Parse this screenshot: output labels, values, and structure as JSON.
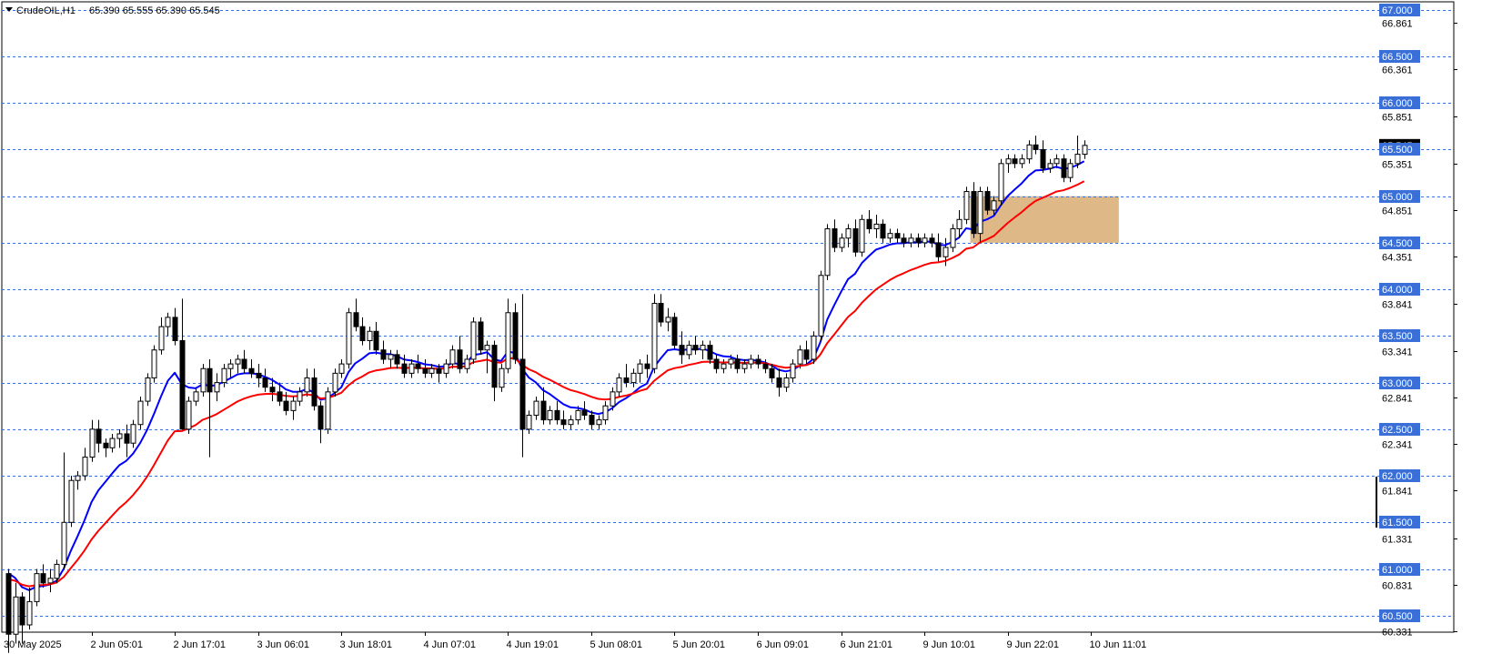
{
  "header": {
    "symbol": "CrudeOIL,H1",
    "ohlc": "65.390 65.555 65.390 65.545"
  },
  "colors": {
    "bull": "#ffffff",
    "bear": "#000000",
    "ema_fast": "#0000ff",
    "ema_slow": "#ff0000",
    "level_line": "#3a6fd8",
    "level_label_bg": "#3a6fd8",
    "zone": "#deb887",
    "current_price_bg": "#000000"
  },
  "chart_data": {
    "type": "candlestick",
    "ylim": [
      60.2,
      67.1
    ],
    "levels": [
      "67.000",
      "66.500",
      "66.000",
      "65.500",
      "65.000",
      "64.500",
      "64.000",
      "63.500",
      "63.000",
      "62.500",
      "62.000",
      "61.500",
      "61.000",
      "60.500"
    ],
    "price_ticks": [
      "66.861",
      "66.361",
      "65.851",
      "65.351",
      "64.851",
      "64.351",
      "63.841",
      "63.341",
      "62.841",
      "62.341",
      "61.841",
      "61.331",
      "60.831",
      "60.331"
    ],
    "time_ticks": [
      {
        "label": "30 May 2025",
        "bar": 0
      },
      {
        "label": "2 Jun 05:01",
        "bar": 12
      },
      {
        "label": "2 Jun 17:01",
        "bar": 24
      },
      {
        "label": "3 Jun 06:01",
        "bar": 36
      },
      {
        "label": "3 Jun 18:01",
        "bar": 48
      },
      {
        "label": "4 Jun 07:01",
        "bar": 60
      },
      {
        "label": "4 Jun 19:01",
        "bar": 72
      },
      {
        "label": "5 Jun 08:01",
        "bar": 84
      },
      {
        "label": "5 Jun 20:01",
        "bar": 96
      },
      {
        "label": "6 Jun 09:01",
        "bar": 108
      },
      {
        "label": "6 Jun 21:01",
        "bar": 120
      },
      {
        "label": "9 Jun 10:01",
        "bar": 132
      },
      {
        "label": "9 Jun 22:01",
        "bar": 144
      },
      {
        "label": "10 Jun 11:01",
        "bar": 156
      }
    ],
    "current_price": 65.545,
    "zone": {
      "from_bar": 139,
      "to_bar": 160,
      "top": 65.0,
      "bottom": 64.5
    },
    "series": [
      {
        "name": "",
        "kind": "ema",
        "period": 9,
        "seed": 61.12
      },
      {
        "name": "",
        "kind": "ema",
        "period": 21,
        "seed": 60.95
      }
    ],
    "candles": [
      [
        60.95,
        61.0,
        60.1,
        60.3
      ],
      [
        60.3,
        60.85,
        60.2,
        60.7
      ],
      [
        60.7,
        60.75,
        60.2,
        60.4
      ],
      [
        60.4,
        60.8,
        60.35,
        60.65
      ],
      [
        60.65,
        61.0,
        60.6,
        60.95
      ],
      [
        60.95,
        61.05,
        60.8,
        60.85
      ],
      [
        60.85,
        61.0,
        60.75,
        60.9
      ],
      [
        60.9,
        61.1,
        60.85,
        61.05
      ],
      [
        61.05,
        62.25,
        61.0,
        61.5
      ],
      [
        61.5,
        62.0,
        61.45,
        61.95
      ],
      [
        61.95,
        62.05,
        61.85,
        62.0
      ],
      [
        62.0,
        62.3,
        61.95,
        62.2
      ],
      [
        62.2,
        62.6,
        62.15,
        62.5
      ],
      [
        62.5,
        62.6,
        62.25,
        62.35
      ],
      [
        62.35,
        62.4,
        62.2,
        62.3
      ],
      [
        62.3,
        62.45,
        62.25,
        62.4
      ],
      [
        62.4,
        62.5,
        62.3,
        62.45
      ],
      [
        62.45,
        62.55,
        62.2,
        62.35
      ],
      [
        62.35,
        62.6,
        62.3,
        62.55
      ],
      [
        62.55,
        62.85,
        62.5,
        62.8
      ],
      [
        62.8,
        63.1,
        62.75,
        63.05
      ],
      [
        63.05,
        63.4,
        63.0,
        63.35
      ],
      [
        63.35,
        63.7,
        63.3,
        63.6
      ],
      [
        63.6,
        63.75,
        63.5,
        63.7
      ],
      [
        63.7,
        63.8,
        63.4,
        63.45
      ],
      [
        63.45,
        63.9,
        62.5,
        62.5
      ],
      [
        62.5,
        62.85,
        62.45,
        62.8
      ],
      [
        62.8,
        62.95,
        62.75,
        62.9
      ],
      [
        62.9,
        63.2,
        62.85,
        63.15
      ],
      [
        63.15,
        63.25,
        62.2,
        62.9
      ],
      [
        62.9,
        63.1,
        62.8,
        63.0
      ],
      [
        63.0,
        63.2,
        62.95,
        63.15
      ],
      [
        63.15,
        63.25,
        63.05,
        63.2
      ],
      [
        63.2,
        63.3,
        63.1,
        63.25
      ],
      [
        63.25,
        63.35,
        63.1,
        63.15
      ],
      [
        63.15,
        63.25,
        63.05,
        63.1
      ],
      [
        63.1,
        63.2,
        62.95,
        63.05
      ],
      [
        63.05,
        63.15,
        62.9,
        62.95
      ],
      [
        62.95,
        63.05,
        62.8,
        62.9
      ],
      [
        62.9,
        63.0,
        62.75,
        62.8
      ],
      [
        62.8,
        62.9,
        62.65,
        62.7
      ],
      [
        62.7,
        62.85,
        62.6,
        62.8
      ],
      [
        62.8,
        62.95,
        62.75,
        62.9
      ],
      [
        62.9,
        63.15,
        62.85,
        63.05
      ],
      [
        63.05,
        63.15,
        62.7,
        62.75
      ],
      [
        62.75,
        62.8,
        62.35,
        62.5
      ],
      [
        62.5,
        62.95,
        62.45,
        62.9
      ],
      [
        62.9,
        63.15,
        62.85,
        63.1
      ],
      [
        63.1,
        63.25,
        63.05,
        63.2
      ],
      [
        63.2,
        63.8,
        63.15,
        63.75
      ],
      [
        63.75,
        63.9,
        63.55,
        63.6
      ],
      [
        63.6,
        63.7,
        63.4,
        63.45
      ],
      [
        63.45,
        63.6,
        63.35,
        63.55
      ],
      [
        63.55,
        63.65,
        63.3,
        63.35
      ],
      [
        63.35,
        63.45,
        63.2,
        63.25
      ],
      [
        63.25,
        63.35,
        63.15,
        63.3
      ],
      [
        63.3,
        63.35,
        63.15,
        63.2
      ],
      [
        63.2,
        63.3,
        63.05,
        63.1
      ],
      [
        63.1,
        63.25,
        63.05,
        63.2
      ],
      [
        63.2,
        63.3,
        63.1,
        63.15
      ],
      [
        63.15,
        63.25,
        63.05,
        63.1
      ],
      [
        63.1,
        63.2,
        63.05,
        63.15
      ],
      [
        63.15,
        63.2,
        63.0,
        63.1
      ],
      [
        63.1,
        63.25,
        63.05,
        63.2
      ],
      [
        63.2,
        63.4,
        63.15,
        63.35
      ],
      [
        63.35,
        63.5,
        63.1,
        63.15
      ],
      [
        63.15,
        63.3,
        63.1,
        63.25
      ],
      [
        63.25,
        63.7,
        63.2,
        63.65
      ],
      [
        63.65,
        63.7,
        63.3,
        63.35
      ],
      [
        63.35,
        63.45,
        63.1,
        63.4
      ],
      [
        63.4,
        63.45,
        62.8,
        62.95
      ],
      [
        62.95,
        63.2,
        62.9,
        63.15
      ],
      [
        63.15,
        63.9,
        63.1,
        63.75
      ],
      [
        63.75,
        63.85,
        63.2,
        63.25
      ],
      [
        63.25,
        63.95,
        62.2,
        62.5
      ],
      [
        62.5,
        62.7,
        62.45,
        62.65
      ],
      [
        62.65,
        62.85,
        62.6,
        62.8
      ],
      [
        62.8,
        62.95,
        62.55,
        62.6
      ],
      [
        62.6,
        62.75,
        62.55,
        62.7
      ],
      [
        62.7,
        62.8,
        62.55,
        62.6
      ],
      [
        62.6,
        62.7,
        62.5,
        62.55
      ],
      [
        62.55,
        62.65,
        62.5,
        62.6
      ],
      [
        62.6,
        62.75,
        62.55,
        62.7
      ],
      [
        62.7,
        62.8,
        62.6,
        62.65
      ],
      [
        62.65,
        62.7,
        62.5,
        62.55
      ],
      [
        62.55,
        62.65,
        62.5,
        62.6
      ],
      [
        62.6,
        62.8,
        62.55,
        62.75
      ],
      [
        62.75,
        62.95,
        62.7,
        62.9
      ],
      [
        62.9,
        63.1,
        62.85,
        63.05
      ],
      [
        63.05,
        63.2,
        62.95,
        63.0
      ],
      [
        63.0,
        63.15,
        62.95,
        63.1
      ],
      [
        63.1,
        63.25,
        63.0,
        63.2
      ],
      [
        63.2,
        63.3,
        63.05,
        63.15
      ],
      [
        63.15,
        63.95,
        63.1,
        63.85
      ],
      [
        63.85,
        63.95,
        63.6,
        63.65
      ],
      [
        63.65,
        63.8,
        63.55,
        63.7
      ],
      [
        63.7,
        63.75,
        63.35,
        63.4
      ],
      [
        63.4,
        63.55,
        63.2,
        63.3
      ],
      [
        63.3,
        63.45,
        63.25,
        63.4
      ],
      [
        63.4,
        63.5,
        63.3,
        63.35
      ],
      [
        63.35,
        63.45,
        63.25,
        63.4
      ],
      [
        63.4,
        63.45,
        63.2,
        63.25
      ],
      [
        63.25,
        63.3,
        63.1,
        63.15
      ],
      [
        63.15,
        63.25,
        63.1,
        63.2
      ],
      [
        63.2,
        63.3,
        63.15,
        63.25
      ],
      [
        63.25,
        63.3,
        63.1,
        63.15
      ],
      [
        63.15,
        63.25,
        63.1,
        63.2
      ],
      [
        63.2,
        63.3,
        63.15,
        63.25
      ],
      [
        63.25,
        63.3,
        63.15,
        63.2
      ],
      [
        63.2,
        63.25,
        63.1,
        63.15
      ],
      [
        63.15,
        63.2,
        63.0,
        63.05
      ],
      [
        63.05,
        63.15,
        62.85,
        62.95
      ],
      [
        62.95,
        63.1,
        62.9,
        63.05
      ],
      [
        63.05,
        63.25,
        63.0,
        63.2
      ],
      [
        63.2,
        63.4,
        63.15,
        63.35
      ],
      [
        63.35,
        63.45,
        63.2,
        63.25
      ],
      [
        63.25,
        63.55,
        63.2,
        63.5
      ],
      [
        63.5,
        64.2,
        63.45,
        64.15
      ],
      [
        64.15,
        64.7,
        64.1,
        64.65
      ],
      [
        64.65,
        64.75,
        64.4,
        64.45
      ],
      [
        64.45,
        64.6,
        64.4,
        64.55
      ],
      [
        64.55,
        64.7,
        64.45,
        64.65
      ],
      [
        64.65,
        64.75,
        64.35,
        64.4
      ],
      [
        64.4,
        64.8,
        64.35,
        64.75
      ],
      [
        64.75,
        64.85,
        64.6,
        64.65
      ],
      [
        64.65,
        64.8,
        64.55,
        64.7
      ],
      [
        64.7,
        64.75,
        64.5,
        64.55
      ],
      [
        64.55,
        64.65,
        64.5,
        64.6
      ],
      [
        64.6,
        64.65,
        64.5,
        64.55
      ],
      [
        64.55,
        64.6,
        64.45,
        64.5
      ],
      [
        64.5,
        64.6,
        64.45,
        64.55
      ],
      [
        64.55,
        64.6,
        64.45,
        64.5
      ],
      [
        64.5,
        64.6,
        64.45,
        64.55
      ],
      [
        64.55,
        64.6,
        64.45,
        64.5
      ],
      [
        64.5,
        64.6,
        64.3,
        64.35
      ],
      [
        64.35,
        64.55,
        64.25,
        64.45
      ],
      [
        64.45,
        64.7,
        64.4,
        64.65
      ],
      [
        64.65,
        64.85,
        64.55,
        64.75
      ],
      [
        64.75,
        65.1,
        64.7,
        65.05
      ],
      [
        65.05,
        65.15,
        64.55,
        64.6
      ],
      [
        64.6,
        65.1,
        64.5,
        65.05
      ],
      [
        65.05,
        65.1,
        64.8,
        64.85
      ],
      [
        64.85,
        65.0,
        64.8,
        64.95
      ],
      [
        64.95,
        65.4,
        64.9,
        65.35
      ],
      [
        65.35,
        65.45,
        65.25,
        65.4
      ],
      [
        65.4,
        65.45,
        65.3,
        65.35
      ],
      [
        65.35,
        65.45,
        65.3,
        65.4
      ],
      [
        65.4,
        65.6,
        65.35,
        65.55
      ],
      [
        65.55,
        65.65,
        65.45,
        65.5
      ],
      [
        65.5,
        65.6,
        65.25,
        65.3
      ],
      [
        65.3,
        65.4,
        65.25,
        65.35
      ],
      [
        65.35,
        65.45,
        65.3,
        65.4
      ],
      [
        65.4,
        65.45,
        65.15,
        65.2
      ],
      [
        65.2,
        65.4,
        65.15,
        65.35
      ],
      [
        65.35,
        65.65,
        65.3,
        65.45
      ],
      [
        65.45,
        65.6,
        65.4,
        65.545
      ]
    ]
  }
}
